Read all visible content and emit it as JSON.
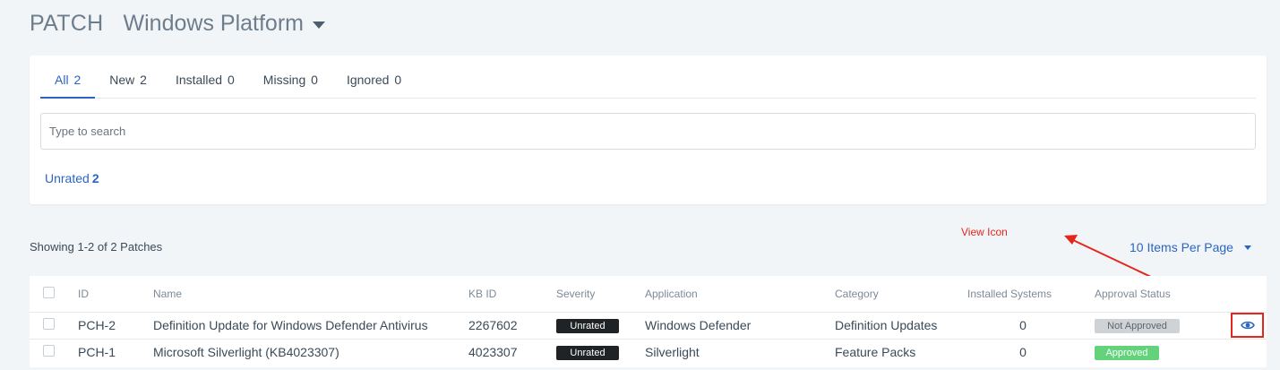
{
  "header": {
    "module": "PATCH",
    "platform": "Windows Platform"
  },
  "tabs": [
    {
      "label": "All",
      "count": "2"
    },
    {
      "label": "New",
      "count": "2"
    },
    {
      "label": "Installed",
      "count": "0"
    },
    {
      "label": "Missing",
      "count": "0"
    },
    {
      "label": "Ignored",
      "count": "0"
    }
  ],
  "search": {
    "placeholder": "Type to search"
  },
  "filters": {
    "unrated_label": "Unrated",
    "unrated_count": "2"
  },
  "summary": {
    "showing": "Showing 1-2 of 2 Patches",
    "per_page": "10 Items Per Page"
  },
  "annotation": {
    "label": "View Icon",
    "color": "#e5261c"
  },
  "table": {
    "columns": [
      "ID",
      "Name",
      "KB ID",
      "Severity",
      "Application",
      "Category",
      "Installed Systems",
      "Approval Status"
    ],
    "rows": [
      {
        "id": "PCH-2",
        "name": "Definition Update for Windows Defender Antivirus",
        "kb": "2267602",
        "severity": "Unrated",
        "application": "Windows Defender",
        "category": "Definition Updates",
        "installed": "0",
        "approval": "Not Approved"
      },
      {
        "id": "PCH-1",
        "name": "Microsoft Silverlight (KB4023307)",
        "kb": "4023307",
        "severity": "Unrated",
        "application": "Silverlight",
        "category": "Feature Packs",
        "installed": "0",
        "approval": "Approved"
      }
    ]
  },
  "icons": {
    "view": "eye-icon",
    "dropdown": "caret-down-icon"
  },
  "colors": {
    "accent": "#2a65c4",
    "approved": "#63d37b",
    "not_approved": "#cfd3d6",
    "severity_badge": "#1f2326"
  }
}
